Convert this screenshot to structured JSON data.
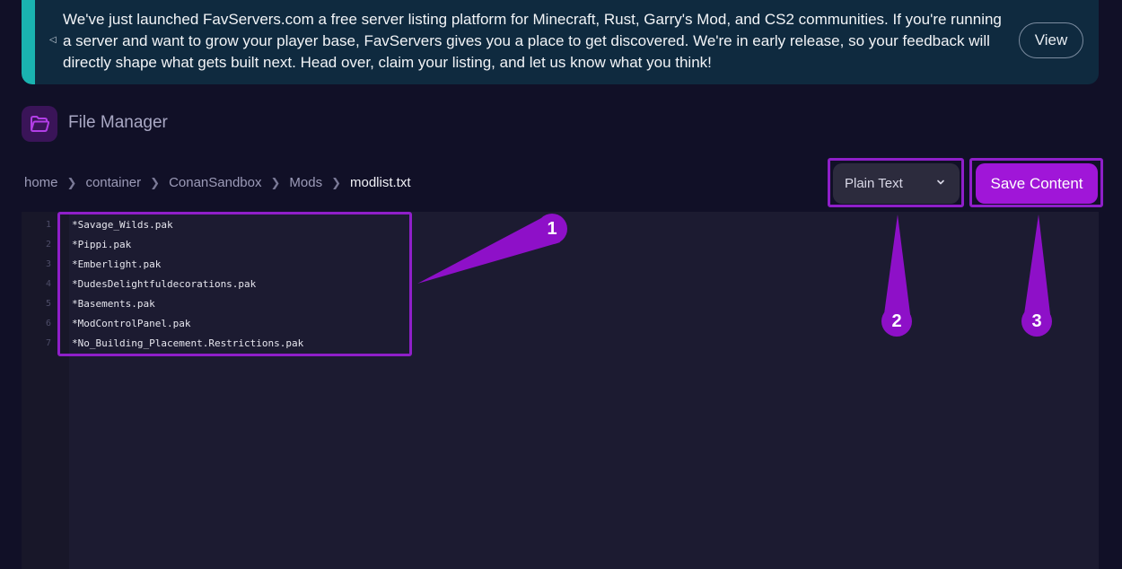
{
  "banner": {
    "message": "We've just launched FavServers.com a free server listing platform for Minecraft, Rust, Garry's Mod, and CS2 communities. If you're running a server and want to grow your player base, FavServers gives you a place to get discovered. We're in early release, so your feedback will directly shape what gets built next. Head over, claim your listing, and let us know what you think!",
    "view_label": "View",
    "icon": "megaphone-icon"
  },
  "header": {
    "title": "File Manager",
    "icon": "folder-open-icon"
  },
  "breadcrumb": {
    "items": [
      "home",
      "container",
      "ConanSandbox",
      "Mods"
    ],
    "current": "modlist.txt"
  },
  "toolbar": {
    "language_selected": "Plain Text",
    "save_label": "Save Content"
  },
  "editor": {
    "line_numbers": [
      "1",
      "2",
      "3",
      "4",
      "5",
      "6",
      "7"
    ],
    "lines": [
      "*Savage_Wilds.pak",
      "*Pippi.pak",
      "*Emberlight.pak",
      "*DudesDelightfuldecorations.pak",
      "*Basements.pak",
      "*ModControlPanel.pak",
      "*No_Building_Placement.Restrictions.pak"
    ]
  },
  "annotations": {
    "labels": [
      "1",
      "2",
      "3"
    ],
    "highlight_color": "#8f1fc9"
  }
}
